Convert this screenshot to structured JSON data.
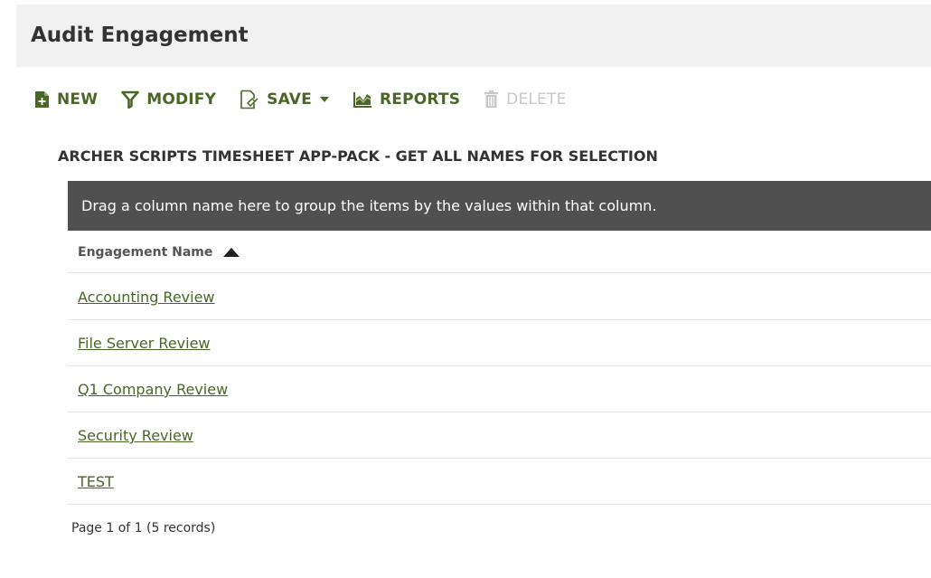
{
  "page": {
    "title": "Audit Engagement"
  },
  "toolbar": {
    "new_label": "NEW",
    "modify_label": "MODIFY",
    "save_label": "SAVE",
    "reports_label": "REPORTS",
    "delete_label": "DELETE"
  },
  "report": {
    "title": "ARCHER SCRIPTS TIMESHEET APP-PACK - GET ALL NAMES FOR SELECTION"
  },
  "grid": {
    "group_panel_text": "Drag a column name here to group the items by the values within that column.",
    "columns": [
      {
        "label": "Engagement Name",
        "sort": "ascending"
      }
    ],
    "rows": [
      {
        "name": "Accounting Review"
      },
      {
        "name": "File Server Review"
      },
      {
        "name": "Q1 Company Review"
      },
      {
        "name": "Security Review"
      },
      {
        "name": "TEST"
      }
    ],
    "pager_text": "Page 1 of 1 (5 records)"
  },
  "colors": {
    "accent_green": "#4b6728",
    "group_panel_bg": "#505050",
    "title_bar_bg": "#f1f1f1",
    "disabled": "#c9c9c9"
  },
  "icons": {
    "new": "new-document-icon",
    "modify": "funnel-filter-icon",
    "save": "save-document-icon",
    "save_menu": "caret-down-icon",
    "reports": "chart-report-icon",
    "delete": "trash-icon",
    "sort": "sort-ascending-icon"
  }
}
